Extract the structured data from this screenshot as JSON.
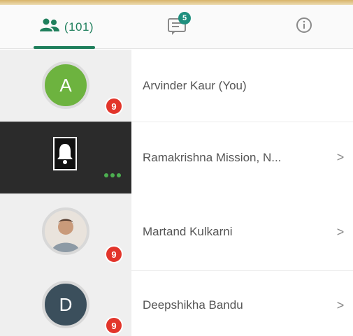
{
  "tabs": {
    "participants_count": "(101)",
    "chat_badge": "5"
  },
  "participants": [
    {
      "initial": "A",
      "name": "Arvinder Kaur (You)",
      "badge": "9",
      "avatar_color": "#6db33f"
    },
    {
      "initial": "",
      "name": "Ramakrishna Mission, N...",
      "badge": "•••",
      "avatar_color": "#111111"
    },
    {
      "initial": "",
      "name": "Martand Kulkarni",
      "badge": "9",
      "avatar_color": "#e9e3dc"
    },
    {
      "initial": "D",
      "name": "Deepshikha Bandu",
      "badge": "9",
      "avatar_color": "#3b4f5c"
    }
  ],
  "colors": {
    "accent": "#1f7f5c",
    "badge_red": "#e2352b"
  }
}
